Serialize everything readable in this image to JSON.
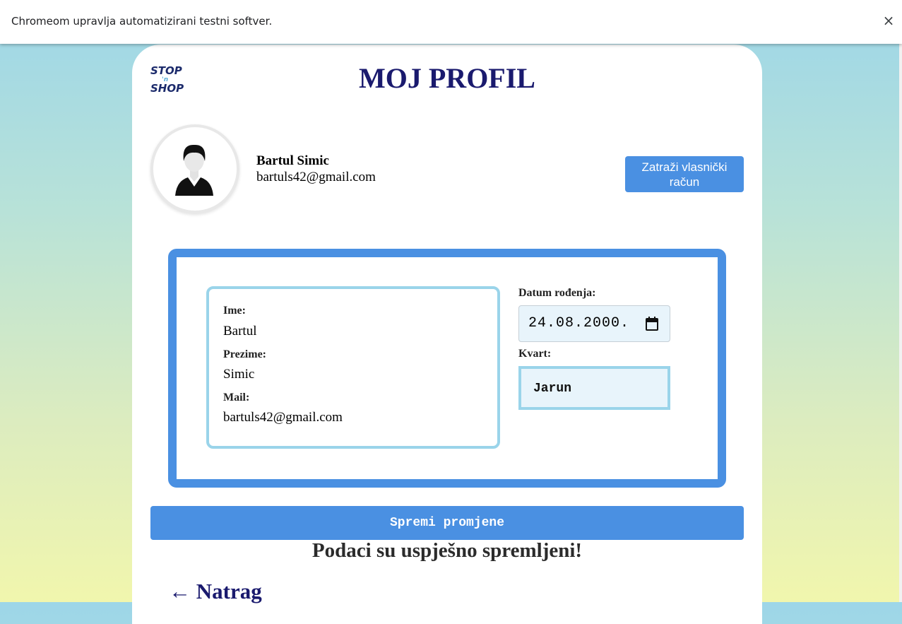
{
  "browser_infobar": {
    "message": "Chromeom upravlja automatizirani testni softver.",
    "close_icon": "×"
  },
  "logo": {
    "line1": "STOP",
    "line2": "'n",
    "line3": "SHOP"
  },
  "page": {
    "title": "MOJ PROFIL"
  },
  "user": {
    "name": "Bartul Simic",
    "email": "bartuls42@gmail.com",
    "avatar_icon": "user-avatar-icon"
  },
  "actions": {
    "request_owner_label": "Zatraži vlasnički račun",
    "save_label": "Spremi promjene",
    "back_label": "← Natrag"
  },
  "form": {
    "first_name_label": "Ime:",
    "first_name_value": "Bartul",
    "last_name_label": "Prezime:",
    "last_name_value": "Simic",
    "mail_label": "Mail:",
    "mail_value": "bartuls42@gmail.com",
    "birth_date_label": "Datum rođenja:",
    "birth_date_value": "24.08.2000.",
    "district_label": "Kvart:",
    "district_value": "Jarun"
  },
  "status": {
    "success_message": "Podaci su uspješno spremljeni!"
  },
  "colors": {
    "accent": "#4a90e2",
    "title": "#1a1a6e",
    "box_border": "#9ad4ea",
    "input_bg": "#e8f4fb"
  }
}
